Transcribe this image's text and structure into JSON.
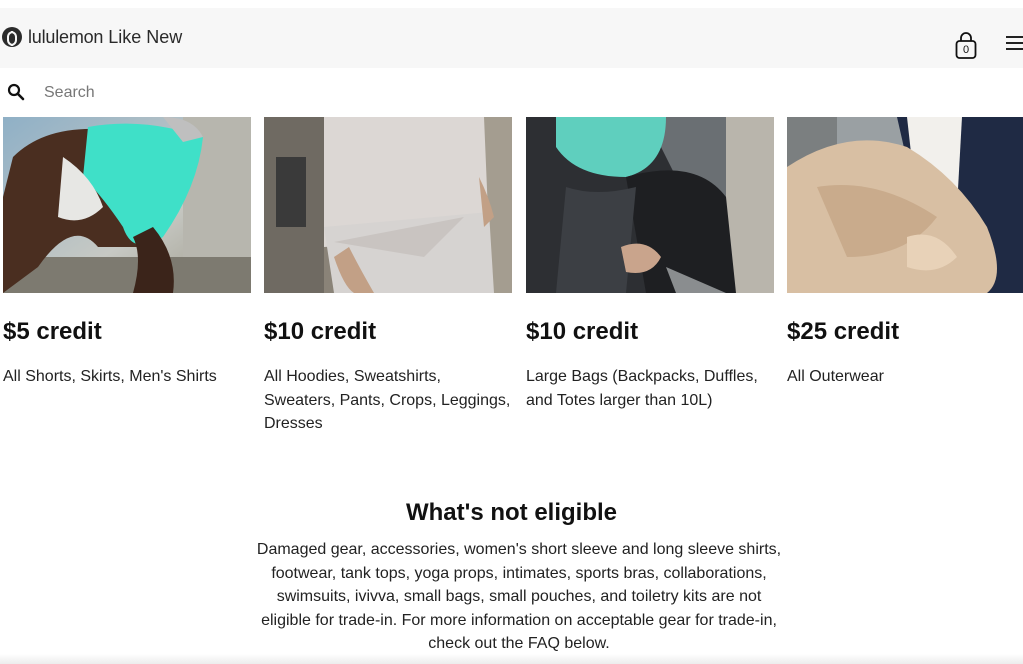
{
  "header": {
    "brand_name": "lululemon",
    "brand_suffix": "Like New",
    "cart_count": "0",
    "icons": [
      "lululemon-logo-icon",
      "shopping-bag-icon",
      "hamburger-menu-icon",
      "search-icon"
    ]
  },
  "search": {
    "placeholder": "Search"
  },
  "cards": [
    {
      "credit": "$5 credit",
      "description": "All Shorts, Skirts, Men's Shirts"
    },
    {
      "credit": "$10 credit",
      "description": "All Hoodies, Sweatshirts, Sweaters, Pants, Crops, Leggings, Dresses"
    },
    {
      "credit": "$10 credit",
      "description": "Large Bags (Backpacks, Duffles, and Totes larger than 10L)"
    },
    {
      "credit": "$25 credit",
      "description": "All Outerwear"
    }
  ],
  "not_eligible": {
    "title": "What's not eligible",
    "body": "Damaged gear, accessories, women's short sleeve and long sleeve shirts, footwear, tank tops, yoga props, intimates, sports bras, collaborations, swimsuits, ivivva, small bags, small pouches, and toiletry kits are not eligible for trade-in. For more information on acceptable gear for trade-in, check out the FAQ below."
  },
  "colors": {
    "header_bg": "#f7f7f7",
    "text": "#1a1a1a"
  }
}
